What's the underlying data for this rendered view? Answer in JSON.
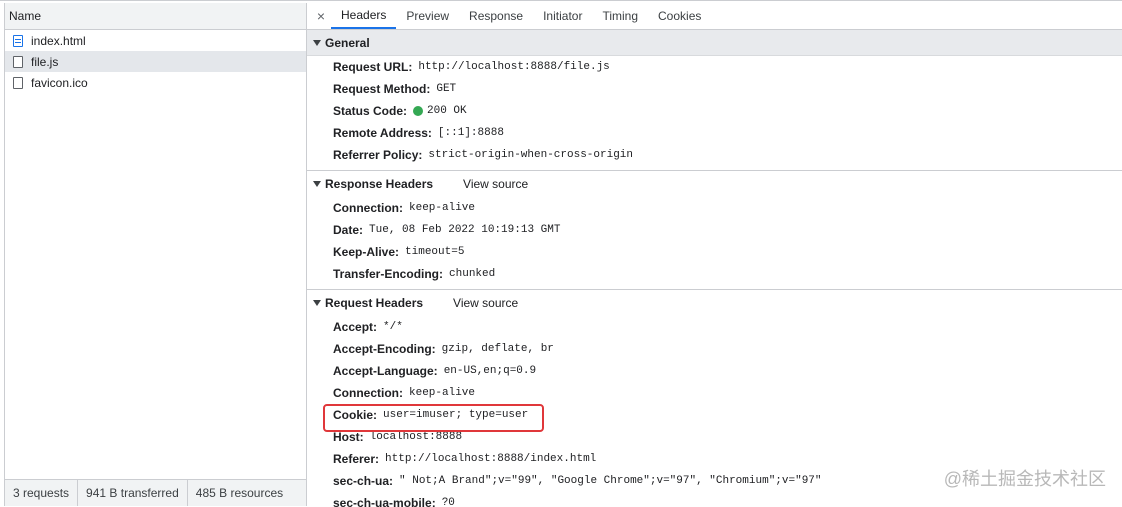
{
  "request_list": {
    "column_header": "Name",
    "items": [
      {
        "name": "index.html",
        "type": "doc"
      },
      {
        "name": "file.js",
        "type": "script"
      },
      {
        "name": "favicon.ico",
        "type": "file"
      }
    ],
    "status": {
      "requests": "3 requests",
      "transferred": "941 B transferred",
      "resources": "485 B resources"
    }
  },
  "tabs": {
    "close": "×",
    "items": [
      "Headers",
      "Preview",
      "Response",
      "Initiator",
      "Timing",
      "Cookies"
    ],
    "active": "Headers"
  },
  "general": {
    "title": "General",
    "rows": [
      {
        "key": "Request URL:",
        "value": "http://localhost:8888/file.js"
      },
      {
        "key": "Request Method:",
        "value": "GET"
      },
      {
        "key": "Status Code:",
        "value": "200 OK"
      },
      {
        "key": "Remote Address:",
        "value": "[::1]:8888"
      },
      {
        "key": "Referrer Policy:",
        "value": "strict-origin-when-cross-origin"
      }
    ]
  },
  "response_headers": {
    "title": "Response Headers",
    "view_source": "View source",
    "rows": [
      {
        "key": "Connection:",
        "value": "keep-alive"
      },
      {
        "key": "Date:",
        "value": "Tue, 08 Feb 2022 10:19:13 GMT"
      },
      {
        "key": "Keep-Alive:",
        "value": "timeout=5"
      },
      {
        "key": "Transfer-Encoding:",
        "value": "chunked"
      }
    ]
  },
  "request_headers": {
    "title": "Request Headers",
    "view_source": "View source",
    "rows": [
      {
        "key": "Accept:",
        "value": "*/*"
      },
      {
        "key": "Accept-Encoding:",
        "value": "gzip, deflate, br"
      },
      {
        "key": "Accept-Language:",
        "value": "en-US,en;q=0.9"
      },
      {
        "key": "Connection:",
        "value": "keep-alive"
      },
      {
        "key": "Cookie:",
        "value": "user=imuser; type=user"
      },
      {
        "key": "Host:",
        "value": "localhost:8888"
      },
      {
        "key": "Referer:",
        "value": "http://localhost:8888/index.html"
      },
      {
        "key": "sec-ch-ua:",
        "value": "\" Not;A Brand\";v=\"99\", \"Google Chrome\";v=\"97\", \"Chromium\";v=\"97\""
      },
      {
        "key": "sec-ch-ua-mobile:",
        "value": "?0"
      }
    ]
  },
  "watermark": "@稀土掘金技术社区",
  "colors": {
    "status_ok": "#34a853",
    "highlight": "#e0373a",
    "tab_active": "#1a73e8"
  }
}
